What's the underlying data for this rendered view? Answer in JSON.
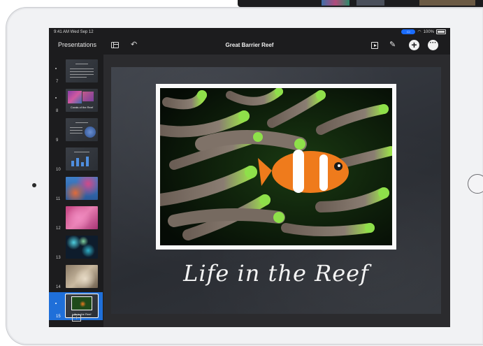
{
  "status_bar": {
    "time": "9:41 AM  Wed Sep 12",
    "battery": "100%"
  },
  "toolbar": {
    "back_label": "Presentations",
    "title": "Great Barrier Reef"
  },
  "navigator": {
    "slides": [
      {
        "number": "7",
        "label": "",
        "selected": false
      },
      {
        "number": "8",
        "label": "Corals of the Reef",
        "selected": false
      },
      {
        "number": "9",
        "label": "",
        "selected": false
      },
      {
        "number": "10",
        "label": "",
        "selected": false
      },
      {
        "number": "11",
        "label": "",
        "selected": false
      },
      {
        "number": "12",
        "label": "",
        "selected": false
      },
      {
        "number": "13",
        "label": "",
        "selected": false
      },
      {
        "number": "14",
        "label": "",
        "selected": false
      },
      {
        "number": "15",
        "label": "Life in the Reef",
        "selected": true
      }
    ]
  },
  "slide": {
    "title": "Life in the Reef"
  },
  "colors": {
    "selection": "#1f6fd9",
    "accent_pill": "#1a6cff",
    "app_bg": "#1c1c1e"
  },
  "icons": [
    "slides-icon",
    "undo-icon",
    "play-icon",
    "brush-icon",
    "add-icon",
    "more-icon",
    "add-slide-icon"
  ]
}
